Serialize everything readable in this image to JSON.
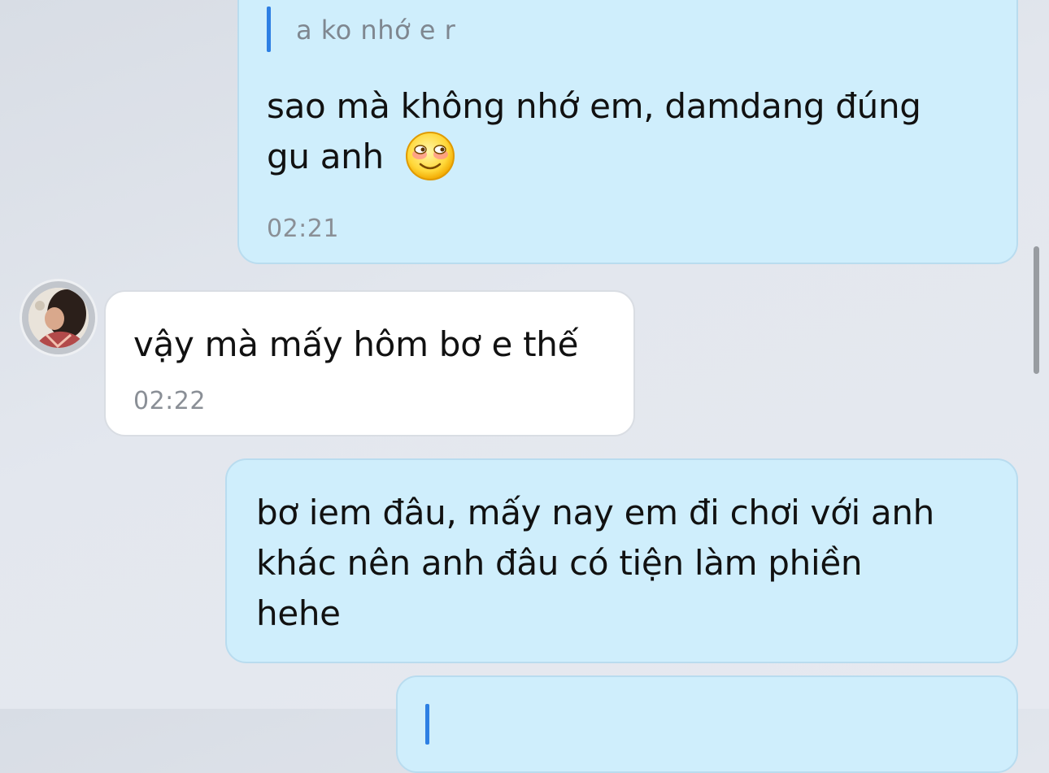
{
  "messages": [
    {
      "direction": "outgoing",
      "quote": "a ko nhớ e r",
      "text": "sao mà không nhớ em, damdang đúng\ngu anh",
      "emoji": "smiling-blushing-face",
      "time": "02:21"
    },
    {
      "direction": "incoming",
      "text": "vậy mà mấy hôm bơ e thế",
      "time": "02:22"
    },
    {
      "direction": "outgoing",
      "text": "bơ iem đâu, mấy nay em đi chơi với anh\nkhác nên anh đâu có tiện làm phiền\nhehe"
    },
    {
      "direction": "outgoing",
      "quote": ""
    }
  ],
  "colors": {
    "outgoing_bubble": "#cfeefc",
    "incoming_bubble": "#ffffff",
    "quote_bar": "#2d7fe3",
    "timestamp": "#8a8f96"
  }
}
